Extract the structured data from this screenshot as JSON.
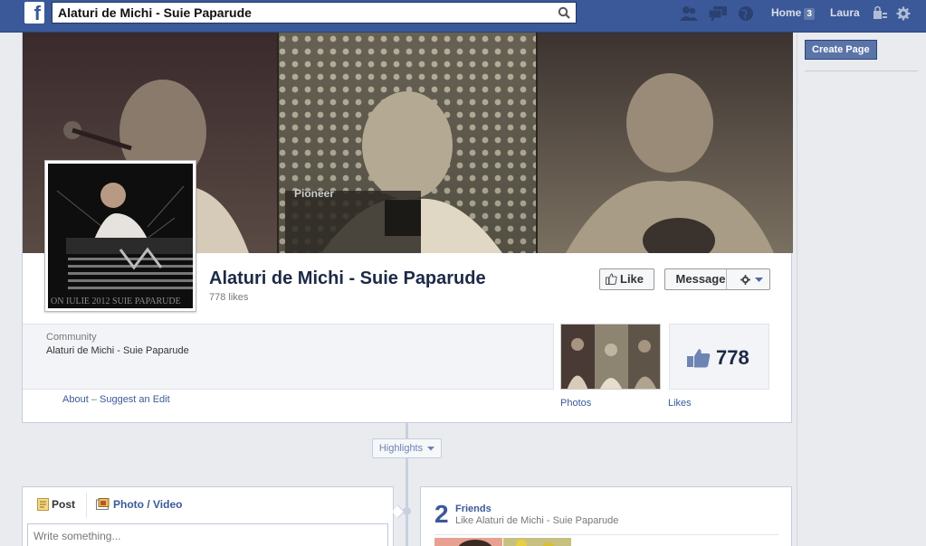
{
  "topbar": {
    "logo": "f",
    "search_value": "Alaturi de Michi - Suie Paparude",
    "home_label": "Home",
    "home_count": "3",
    "user_name": "Laura"
  },
  "right": {
    "create_page_label": "Create Page"
  },
  "page": {
    "name": "Alaturi de Michi - Suie Paparude",
    "likes_text": "778 likes",
    "like_button": "Like",
    "message_button": "Message",
    "profile_caption": "ON  IULIE  2012  SUIE  PAPARUDE"
  },
  "about": {
    "category_label": "Community",
    "category_value": "Alaturi de Michi - Suie Paparude",
    "about_link": "About",
    "separator": "–",
    "suggest_link": "Suggest an Edit"
  },
  "apps": {
    "photos_label": "Photos",
    "likes_label": "Likes",
    "likes_number": "778"
  },
  "timeline": {
    "highlights_label": "Highlights"
  },
  "composer": {
    "post_tab": "Post",
    "photo_tab": "Photo / Video",
    "placeholder": "Write something..."
  },
  "friends": {
    "count": "2",
    "title": "Friends",
    "subtitle": "Like Alaturi de Michi - Suie Paparude"
  },
  "colors": {
    "topbar": "#3b5998",
    "link": "#3b5998",
    "page_bg": "#e9ebee"
  }
}
